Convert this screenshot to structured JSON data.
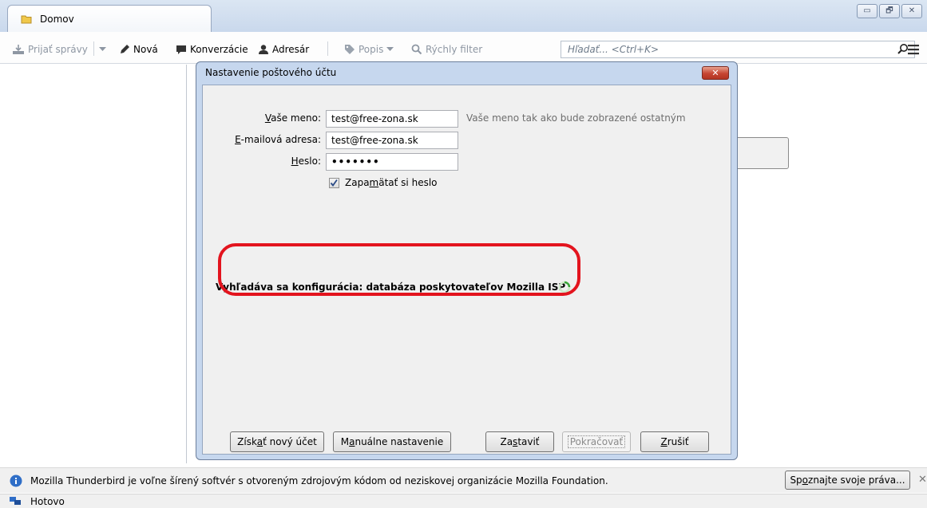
{
  "tab": {
    "label": "Domov"
  },
  "window_controls": {
    "minimize": "▭",
    "restore": "🗗",
    "close": "✕"
  },
  "toolbar": {
    "get_mail": "Prijať správy",
    "new": "Nová",
    "chat": "Konverzácie",
    "address_book": "Adresár",
    "tag": "Popis",
    "quick_filter": "Rýchly filter",
    "search_placeholder": "Hľadať... <Ctrl+K>"
  },
  "dialog": {
    "title": "Nastavenie poštového účtu",
    "close_label": "✕",
    "name_label_u": "V",
    "name_label_rest": "aše meno:",
    "name_value": "test@free-zona.sk",
    "name_hint": "Vaše meno tak ako bude zobrazené ostatným",
    "email_label_u": "E",
    "email_label_rest": "-mailová adresa:",
    "email_value": "test@free-zona.sk",
    "password_label_u": "H",
    "password_label_rest": "eslo:",
    "password_value": "•••••••",
    "remember_a": "Zapa",
    "remember_u": "m",
    "remember_b": "ätať si heslo",
    "remember_checked": true,
    "status": "Vyhľadáva sa konfigurácia: databáza poskytovateľov Mozilla ISP",
    "buttons": {
      "new_account_a": "Získ",
      "new_account_u": "a",
      "new_account_b": "ť nový účet",
      "manual_a": "M",
      "manual_u": "a",
      "manual_b": "nuálne nastavenie",
      "stop_a": "Za",
      "stop_u": "s",
      "stop_b": "taviť",
      "continue": "Pokračovať",
      "cancel_u": "Z",
      "cancel_b": "rušiť"
    }
  },
  "notification": {
    "message": "Mozilla Thunderbird je voľne šírený softvér s otvoreným zdrojovým kódom od neziskovej organizácie Mozilla Foundation.",
    "rights_a": "Sp",
    "rights_u": "o",
    "rights_b": "znajte svoje práva...",
    "close": "✕"
  },
  "statusbar": {
    "text": "Hotovo"
  },
  "colors": {
    "accent": "#2f6ec7",
    "highlight_ring": "#e3141e",
    "spinner": "#3aa63a"
  }
}
